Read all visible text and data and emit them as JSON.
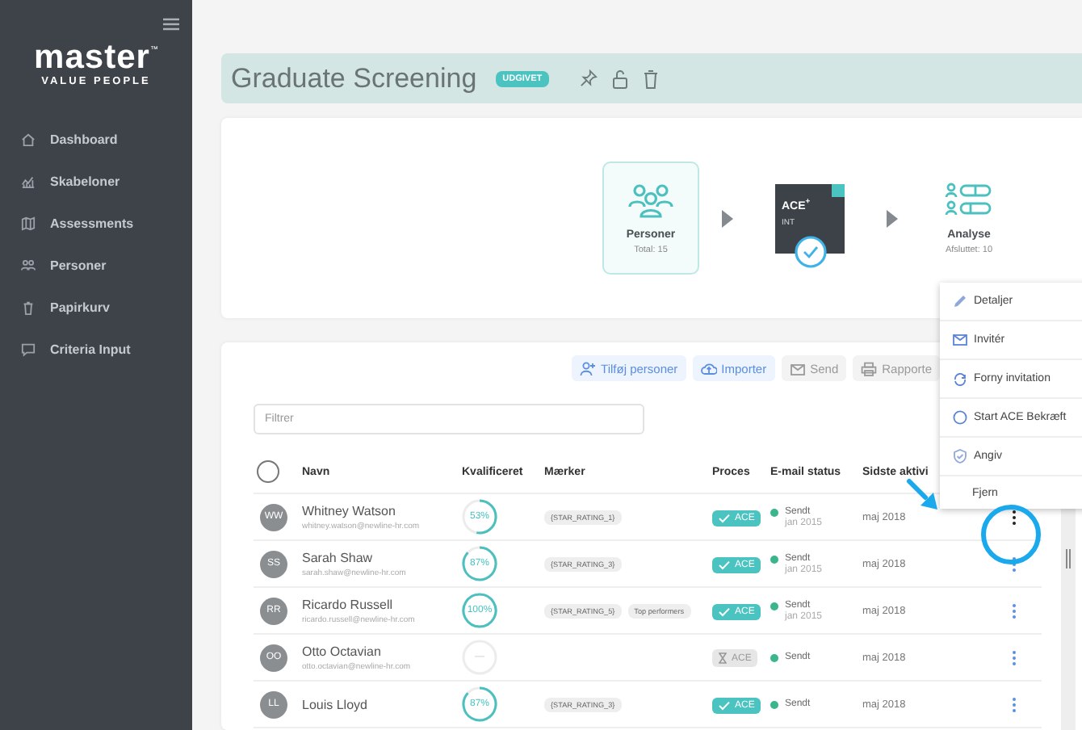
{
  "sidebar": {
    "logo": {
      "word": "master",
      "mark": "™",
      "tagline": "VALUE PEOPLE"
    },
    "items": [
      {
        "label": "Dashboard",
        "selected": false
      },
      {
        "label": "Skabeloner",
        "selected": false
      },
      {
        "label": "Assessments",
        "selected": false
      },
      {
        "label": "Personer",
        "selected": false
      },
      {
        "label": "Papirkurv",
        "selected": false
      },
      {
        "label": "Criteria Input",
        "selected": false
      }
    ]
  },
  "header": {
    "title": "Graduate Screening",
    "badge": "UDGIVET"
  },
  "flow": {
    "people": {
      "label": "Personer",
      "sub": "Total: 15"
    },
    "test": {
      "name": "ACE",
      "sup": "+",
      "sub": "INT",
      "done": true
    },
    "analysis": {
      "label": "Analyse",
      "sub": "Afsluttet: 10"
    }
  },
  "toolbar": [
    {
      "label": "Tilføj personer",
      "disabled": false
    },
    {
      "label": "Importer",
      "disabled": false
    },
    {
      "label": "Send",
      "disabled": true
    },
    {
      "label": "Rapporte",
      "disabled": true
    }
  ],
  "filter": {
    "placeholder": "Filtrer"
  },
  "table": {
    "select_all": {
      "checked": false
    },
    "columns": [
      "Navn",
      "Kvalificeret",
      "Mærker",
      "Proces",
      "E-mail status",
      "Sidste aktivi"
    ],
    "rows": [
      {
        "initials": "WW",
        "name": "Whitney Watson",
        "email": "whitney.watson@newline-hr.com",
        "qualified": {
          "text": "53%",
          "level": 0.53
        },
        "tags": [
          "{STAR_RATING_1}"
        ],
        "process": {
          "label": "ACE",
          "done": true
        },
        "email_status": "Sendt",
        "email_date": "jan 2015",
        "last_active": "maj 2018",
        "selected": true
      },
      {
        "initials": "SS",
        "name": "Sarah Shaw",
        "email": "sarah.shaw@newline-hr.com",
        "qualified": {
          "text": "87%",
          "level": 0.87
        },
        "tags": [
          "{STAR_RATING_3}"
        ],
        "process": {
          "label": "ACE",
          "done": true
        },
        "email_status": "Sendt",
        "email_date": "jan 2015",
        "last_active": "maj 2018",
        "selected": false
      },
      {
        "initials": "RR",
        "name": "Ricardo Russell",
        "email": "ricardo.russell@newline-hr.com",
        "qualified": {
          "text": "100%",
          "level": 1
        },
        "tags": [
          "{STAR_RATING_5}",
          "Top performers"
        ],
        "process": {
          "label": "ACE",
          "done": true
        },
        "email_status": "Sendt",
        "email_date": "jan 2015",
        "last_active": "maj 2018",
        "selected": false
      },
      {
        "initials": "OO",
        "name": "Otto Octavian",
        "email": "otto.octavian@newline-hr.com",
        "qualified": {
          "text": "—"
        },
        "tags": [],
        "process": {
          "label": "ACE",
          "done": false
        },
        "email_status": "Sendt",
        "last_active": "maj 2018",
        "selected": false
      },
      {
        "initials": "LL",
        "name": "Louis Lloyd",
        "qualified": {
          "text": "87%",
          "level": 0.87
        },
        "tags": [
          "{STAR_RATING_3}"
        ],
        "process": {
          "label": "ACE",
          "done": true
        },
        "email_status": "Sendt",
        "last_active": "maj 2018",
        "selected": false
      }
    ]
  },
  "context_menu": [
    "Detaljer",
    "Invitér",
    "Forny invitation",
    "Start ACE Bekræft",
    "Angiv",
    "Fjern"
  ]
}
